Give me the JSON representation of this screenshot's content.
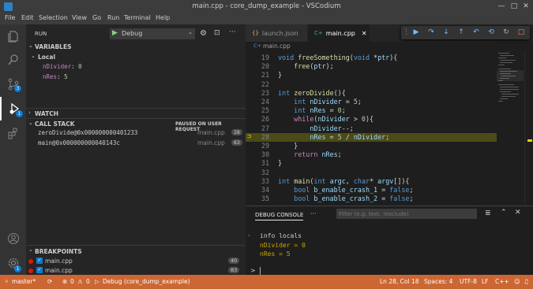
{
  "window": {
    "title": "main.cpp - core_dump_example - VSCodium",
    "minimize_glyph": "—",
    "maximize_glyph": "□",
    "close_glyph": "✕"
  },
  "menu": [
    "File",
    "Edit",
    "Selection",
    "View",
    "Go",
    "Run",
    "Terminal",
    "Help"
  ],
  "activity_bar": {
    "badges": {
      "source_control": "3",
      "run_debug": "1",
      "settings": "1"
    }
  },
  "sidebar": {
    "title": "RUN",
    "launch_config": "Debug",
    "variables": {
      "header": "VARIABLES",
      "scope": "Local",
      "items": [
        {
          "name": "nDivider",
          "value": "0"
        },
        {
          "name": "nRes",
          "value": "5"
        }
      ]
    },
    "watch_header": "WATCH",
    "call_stack": {
      "header": "CALL STACK",
      "status": "PAUSED ON USER REQUEST",
      "frames": [
        {
          "name": "zeroDivide@0x000000000401233",
          "file": "main.cpp",
          "line": "28"
        },
        {
          "name": "main@0x000000000040143c",
          "file": "main.cpp",
          "line": "63"
        }
      ]
    },
    "breakpoints": {
      "header": "BREAKPOINTS",
      "items": [
        {
          "file": "main.cpp",
          "line": "40"
        },
        {
          "file": "main.cpp",
          "line": "83"
        }
      ]
    }
  },
  "editor": {
    "tabs": [
      {
        "label": "launch.json",
        "icon": "{}",
        "active": false
      },
      {
        "label": "main.cpp",
        "icon": "C+",
        "active": true
      }
    ],
    "breadcrumb": "main.cpp",
    "current_line": 28,
    "lines": [
      {
        "n": "19",
        "html": "<span class='kw'>void</span> <span class='fn'>freeSomething</span>(<span class='kw'>void</span> *<span class='vr'>ptr</span>){"
      },
      {
        "n": "20",
        "html": "    <span class='fn'>free</span>(<span class='vr'>ptr</span>);"
      },
      {
        "n": "21",
        "html": "}"
      },
      {
        "n": "22",
        "html": ""
      },
      {
        "n": "23",
        "html": "<span class='kw'>int</span> <span class='fn'>zeroDivide</span>(){"
      },
      {
        "n": "24",
        "html": "    <span class='kw'>int</span> <span class='vr'>nDivider</span> = <span class='num'>5</span>;"
      },
      {
        "n": "25",
        "html": "    <span class='kw'>int</span> <span class='vr'>nRes</span> = <span class='num'>0</span>;"
      },
      {
        "n": "26",
        "html": "    <span class='ctl'>while</span>(<span class='vr'>nDivider</span> > <span class='num'>0</span>){"
      },
      {
        "n": "27",
        "html": "        <span class='vr'>nDivider</span>--;"
      },
      {
        "n": "28",
        "html": "        <span class='vr'>nRes</span> = <span class='num'>5</span> / <span class='vr'>nDivider</span>;"
      },
      {
        "n": "29",
        "html": "    }"
      },
      {
        "n": "30",
        "html": "    <span class='ctl'>return</span> <span class='vr'>nRes</span>;"
      },
      {
        "n": "31",
        "html": "}"
      },
      {
        "n": "32",
        "html": ""
      },
      {
        "n": "33",
        "html": "<span class='kw'>int</span> <span class='fn'>main</span>(<span class='kw'>int</span> <span class='vr'>argc</span>, <span class='kw'>char</span>* <span class='vr'>argv</span>[]){"
      },
      {
        "n": "34",
        "html": "    <span class='kw'>bool</span> <span class='vr'>b_enable_crash_1</span> = <span class='kw'>false</span>;"
      },
      {
        "n": "35",
        "html": "    <span class='kw'>bool</span> <span class='vr'>b_enable_crash_2</span> = <span class='kw'>false</span>;"
      }
    ]
  },
  "panel": {
    "tab_label": "DEBUG CONSOLE",
    "more": "···",
    "filter_placeholder": "Filter (e.g. text, !exclude)",
    "output": [
      {
        "text": "info locals",
        "type": "input"
      },
      {
        "text": "nDivider = 0",
        "type": "result"
      },
      {
        "text": "nRes = 5",
        "type": "result"
      }
    ],
    "prompt": ">"
  },
  "statusbar": {
    "branch": "master*",
    "errors": "0",
    "warnings": "0",
    "debug_label": "Debug (core_dump_example)",
    "position": "Ln 28, Col 18",
    "spaces": "Spaces: 4",
    "encoding": "UTF-8",
    "eol": "LF",
    "language": "C++"
  },
  "colors": {
    "statusbar": "#cc6633",
    "accent": "#0e7ad3",
    "current_line": "#4b4b18",
    "debug_arrow": "#ffcc00"
  }
}
